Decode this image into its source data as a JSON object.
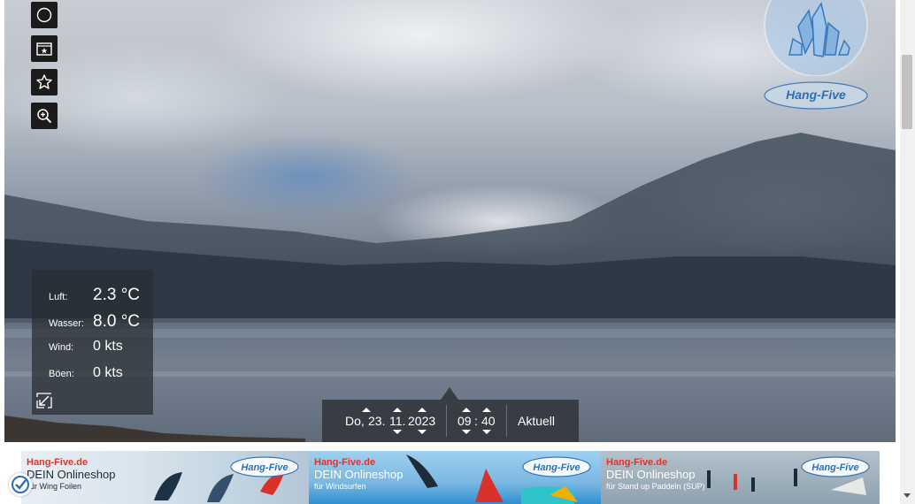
{
  "toolbar": {
    "items": [
      {
        "icon": "history-icon"
      },
      {
        "icon": "gallery-icon"
      },
      {
        "icon": "favorite-star-icon"
      },
      {
        "icon": "zoom-in-icon"
      }
    ]
  },
  "weather": {
    "air_label": "Luft:",
    "air_value": "2.3 °C",
    "water_label": "Wasser:",
    "water_value": "8.0 °C",
    "wind_label": "Wind:",
    "wind_value": "0 kts",
    "gust_label": "Böen:",
    "gust_value": "0 kts"
  },
  "datetime": {
    "weekday": "Do,",
    "day": "23.",
    "month": "11.",
    "year": "2023",
    "hour": "09",
    "time_separator": ":",
    "minute": "40",
    "current_label": "Aktuell"
  },
  "logos": {
    "sponsor": "Hang-Five"
  },
  "ads": [
    {
      "brand": "Hang-Five.de",
      "line1": "DEIN Onlineshop",
      "line2": "ür Wing Foilen"
    },
    {
      "brand": "Hang-Five.de",
      "line1": "DEIN Onlineshop",
      "line2": "für Windsurfen"
    },
    {
      "brand": "Hang-Five.de",
      "line1": "DEIN Onlineshop",
      "line2": "für Stand up Paddeln (SUP)"
    }
  ],
  "colors": {
    "panel_bg": "#282c32",
    "brand_red": "#e5302a",
    "logo_blue": "#2a6fb5"
  }
}
